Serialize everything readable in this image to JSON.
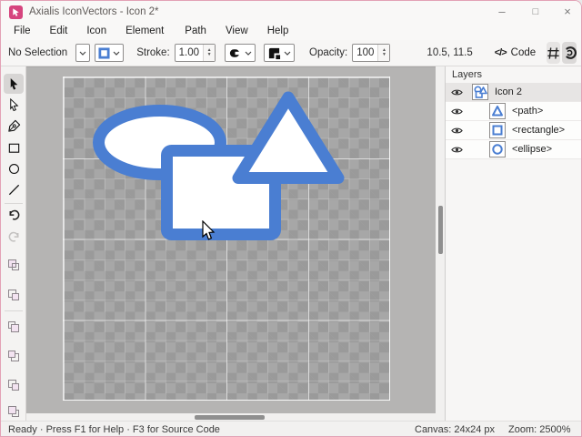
{
  "window": {
    "title": "Axialis IconVectors - Icon 2*",
    "controls": {
      "minimize": "–",
      "maximize": "□",
      "close": "×"
    },
    "accent_color": "#d6447e"
  },
  "menu": {
    "items": [
      "File",
      "Edit",
      "Icon",
      "Element",
      "Path",
      "View",
      "Help"
    ]
  },
  "toolbar": {
    "selection_status": "No Selection",
    "stroke_label": "Stroke:",
    "stroke_value": "1.00",
    "opacity_label": "Opacity:",
    "opacity_value": "100",
    "coordinates": "10.5, 11.5",
    "code_glyph": "</>",
    "code_label": "Code",
    "icons": [
      "shape-style-select",
      "fill-color-select",
      "line-cap-select",
      "line-join-select",
      "grid-toggle",
      "snap-rotate-toggle",
      "zoom-in",
      "zoom-out",
      "center-view"
    ]
  },
  "tools": {
    "icons": [
      "select",
      "direct-select",
      "pen",
      "rectangle",
      "ellipse",
      "line",
      "undo",
      "redo",
      "boolean-union",
      "boolean-subtract",
      "bring-to-front",
      "send-to-back",
      "bring-forward",
      "send-backward"
    ],
    "active": "select"
  },
  "canvas": {
    "stroke_color": "#4a7ed2",
    "fill_color": "#ffffff",
    "checker_colors": [
      "#a7a7a7",
      "#9a9a9a"
    ],
    "shapes": [
      "ellipse",
      "rectangle",
      "path-triangle"
    ]
  },
  "layers": {
    "header": "Layers",
    "rows": [
      {
        "label": "Icon 2",
        "selected": true
      },
      {
        "label": "<path>",
        "selected": false
      },
      {
        "label": "<rectangle>",
        "selected": false
      },
      {
        "label": "<ellipse>",
        "selected": false
      }
    ]
  },
  "statusbar": {
    "left": "Ready · Press F1 for Help · F3 for Source Code",
    "canvas_size": "Canvas: 24x24 px",
    "zoom": "Zoom: 2500%"
  }
}
